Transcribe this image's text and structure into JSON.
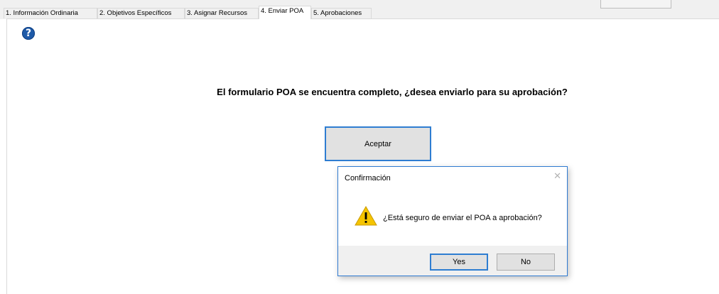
{
  "tabs": [
    {
      "label": "1. Información Ordinaria",
      "active": false
    },
    {
      "label": "2. Objetivos Específicos",
      "active": false
    },
    {
      "label": "3. Asignar Recursos",
      "active": false
    },
    {
      "label": "4. Enviar POA",
      "active": true
    },
    {
      "label": "5. Aprobaciones",
      "active": false
    }
  ],
  "help": {
    "icon": "help-question-icon",
    "glyph": "?"
  },
  "main": {
    "question": "El formulario POA se encuentra completo, ¿desea enviarlo para su aprobación?",
    "accept_label": "Aceptar"
  },
  "dialog": {
    "title": "Confirmación",
    "close_glyph": "✕",
    "icon": "warning-icon",
    "message": "¿Está seguro de enviar el POA a aprobación?",
    "yes_label": "Yes",
    "no_label": "No"
  },
  "colors": {
    "accent": "#2e7dd1",
    "button_bg": "#e1e1e1",
    "footer_bg": "#f0f0f0",
    "warning": "#f5c400"
  }
}
